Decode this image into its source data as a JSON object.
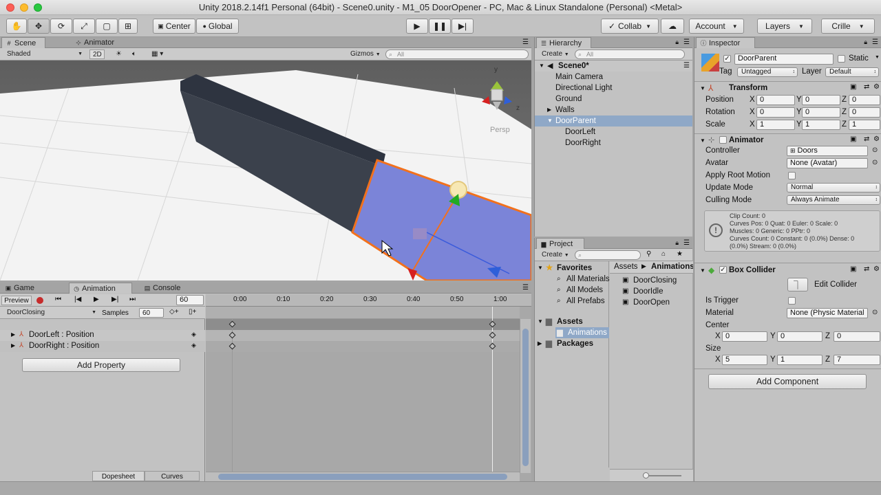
{
  "window": {
    "title": "Unity 2018.2.14f1 Personal (64bit) - Scene0.unity - M1_05 DoorOpener - PC, Mac & Linux Standalone (Personal) <Metal>"
  },
  "toolbar": {
    "center": "Center",
    "global": "Global",
    "collab": "Collab",
    "account": "Account",
    "layers": "Layers",
    "layout": "Crille"
  },
  "scene": {
    "tabs": [
      "Scene",
      "Animator"
    ],
    "shading": "Shaded",
    "mode2d": "2D",
    "gizmos": "Gizmos",
    "search_placeholder": "All",
    "persp": "Persp",
    "axis_y": "y",
    "axis_z": "z"
  },
  "bottom": {
    "tabs": [
      "Game",
      "Animation",
      "Console"
    ]
  },
  "animation": {
    "preview": "Preview",
    "frame": "60",
    "clip": "DoorClosing",
    "samples_label": "Samples",
    "samples": "60",
    "ticks": [
      "0:00",
      "0:10",
      "0:20",
      "0:30",
      "0:40",
      "0:50",
      "1:00"
    ],
    "properties": [
      "DoorLeft : Position",
      "DoorRight : Position"
    ],
    "add_property": "Add Property",
    "dopesheet": "Dopesheet",
    "curves": "Curves"
  },
  "hierarchy": {
    "tab": "Hierarchy",
    "create": "Create",
    "search_placeholder": "All",
    "scene": "Scene0*",
    "items": [
      "Main Camera",
      "Directional Light",
      "Ground",
      "Walls",
      "DoorParent",
      "DoorLeft",
      "DoorRight"
    ]
  },
  "project": {
    "tab": "Project",
    "create": "Create",
    "favorites": "Favorites",
    "fav_items": [
      "All Materials",
      "All Models",
      "All Prefabs"
    ],
    "assets": "Assets",
    "anim_folder": "Animations",
    "packages": "Packages",
    "breadcrumb_root": "Assets",
    "breadcrumb_leaf": "Animations",
    "files": [
      "DoorClosing",
      "DoorIdle",
      "DoorOpen"
    ]
  },
  "inspector": {
    "tab": "Inspector",
    "object_name": "DoorParent",
    "static_label": "Static",
    "tag_label": "Tag",
    "tag_value": "Untagged",
    "layer_label": "Layer",
    "layer_value": "Default",
    "transform": {
      "title": "Transform",
      "position": "Position",
      "rotation": "Rotation",
      "scale": "Scale",
      "x": "X",
      "y": "Y",
      "z": "Z",
      "pos": [
        "0",
        "0",
        "0"
      ],
      "rot": [
        "0",
        "0",
        "0"
      ],
      "scl": [
        "1",
        "1",
        "1"
      ]
    },
    "animator": {
      "title": "Animator",
      "controller_label": "Controller",
      "controller_value": "Doors",
      "avatar_label": "Avatar",
      "avatar_value": "None (Avatar)",
      "apply_root_motion": "Apply Root Motion",
      "update_mode": "Update Mode",
      "update_mode_value": "Normal",
      "culling_mode": "Culling Mode",
      "culling_mode_value": "Always Animate",
      "info": [
        "Clip Count: 0",
        "Curves Pos: 0 Quat: 0 Euler: 0 Scale: 0",
        "Muscles: 0 Generic: 0 PPtr: 0",
        "Curves Count: 0 Constant: 0 (0.0%) Dense: 0",
        "(0.0%) Stream: 0 (0.0%)"
      ]
    },
    "collider": {
      "title": "Box Collider",
      "edit": "Edit Collider",
      "is_trigger": "Is Trigger",
      "material_label": "Material",
      "material_value": "None (Physic Material",
      "center": "Center",
      "size": "Size",
      "x": "X",
      "y": "Y",
      "z": "Z",
      "center_v": [
        "0",
        "0",
        "0"
      ],
      "size_v": [
        "5",
        "1",
        "7"
      ]
    },
    "add_component": "Add Component"
  },
  "colors": {
    "accent": "#3d6bd9",
    "selection": "#8fa8c7",
    "record": "#c62b2b",
    "door_fill": "#7b84d8",
    "outline": "#f2711c"
  }
}
